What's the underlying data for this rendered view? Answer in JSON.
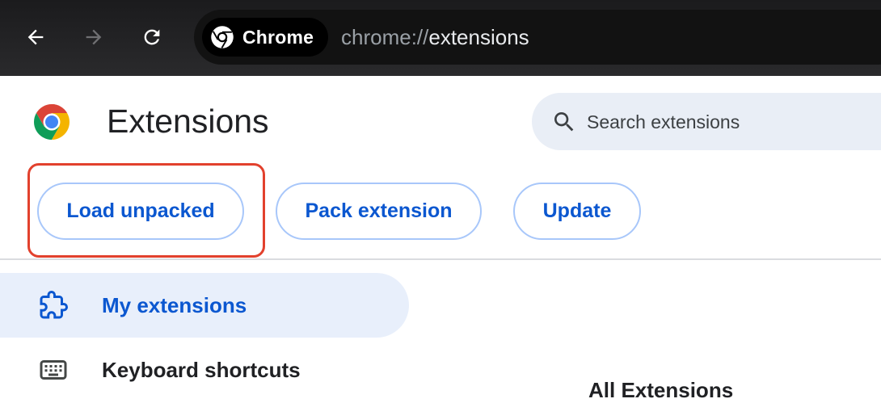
{
  "browser": {
    "chip_label": "Chrome",
    "url_scheme": "chrome://",
    "url_host": "extensions"
  },
  "header": {
    "title": "Extensions",
    "search_placeholder": "Search extensions"
  },
  "toolbar": {
    "load_unpacked_label": "Load unpacked",
    "pack_extension_label": "Pack extension",
    "update_label": "Update"
  },
  "sidebar": {
    "items": [
      {
        "label": "My extensions",
        "icon": "puzzle-icon",
        "active": true
      },
      {
        "label": "Keyboard shortcuts",
        "icon": "keyboard-icon",
        "active": false
      }
    ]
  },
  "main": {
    "section_heading_partial": "All Extensions"
  },
  "colors": {
    "accent": "#0b57d0",
    "button_border": "#a8c7fa",
    "highlight": "#e2412d",
    "active_nav_bg": "#e8effb"
  }
}
